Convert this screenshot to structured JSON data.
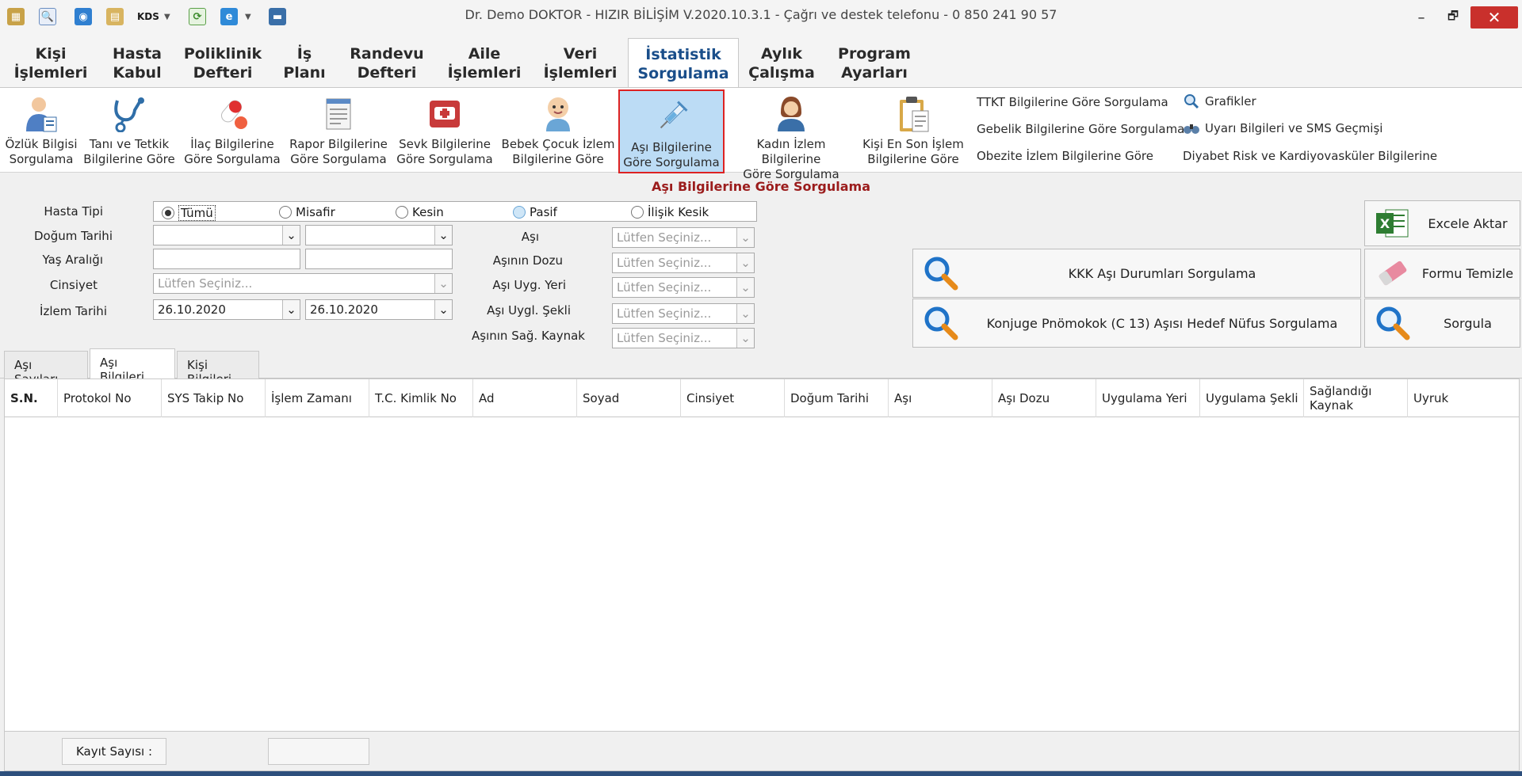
{
  "window": {
    "title": "Dr. Demo DOKTOR - HIZIR BİLİŞİM V.2020.10.3.1 - Çağrı ve destek telefonu - 0 850 241 90 57",
    "quick_access": {
      "kds_label": "KDS"
    },
    "controls": {
      "minimize": "–",
      "restore": "🗗",
      "close": "✕"
    }
  },
  "menu_tabs": [
    {
      "label": "Kişi\nİşlemleri"
    },
    {
      "label": "Hasta\nKabul"
    },
    {
      "label": "Poliklinik\nDefteri"
    },
    {
      "label": "İş\nPlanı"
    },
    {
      "label": "Randevu\nDefteri"
    },
    {
      "label": "Aile\nİşlemleri"
    },
    {
      "label": "Veri\nİşlemleri"
    },
    {
      "label": "İstatistik\nSorgulama"
    },
    {
      "label": "Aylık\nÇalışma"
    },
    {
      "label": "Program\nAyarları"
    }
  ],
  "ribbon": {
    "buttons": [
      {
        "label": "Özlük Bilgisi\nSorgulama",
        "icon": "doctor-icon"
      },
      {
        "label": "Tanı ve Tetkik\nBilgilerine Göre",
        "icon": "stethoscope-icon"
      },
      {
        "label": "İlaç Bilgilerine\nGöre Sorgulama",
        "icon": "pills-icon"
      },
      {
        "label": "Rapor Bilgilerine\nGöre Sorgulama",
        "icon": "report-icon"
      },
      {
        "label": "Sevk Bilgilerine\nGöre Sorgulama",
        "icon": "ambulance-icon"
      },
      {
        "label": "Bebek Çocuk İzlem\nBilgilerine Göre",
        "icon": "baby-icon"
      },
      {
        "label": "Aşı Bilgilerine\nGöre Sorgulama",
        "icon": "syringe-icon"
      },
      {
        "label": "Kadın İzlem Bilgilerine\nGöre Sorgulama",
        "icon": "woman-icon"
      },
      {
        "label": "Kişi En Son İşlem\nBilgilerine Göre",
        "icon": "clipboard-icon"
      }
    ],
    "links_col1": [
      "TTKT Bilgilerine Göre Sorgulama",
      "Gebelik Bilgilerine Göre Sorgulama",
      "Obezite İzlem Bilgilerine Göre"
    ],
    "links_col2": [
      "Grafikler",
      "Uyarı Bilgileri ve SMS Geçmişi",
      "Diyabet Risk ve Kardiyovasküler Bilgilerine"
    ]
  },
  "form": {
    "title": "Aşı Bilgilerine Göre Sorgulama",
    "labels": {
      "hasta_tipi": "Hasta Tipi",
      "dogum_tarihi": "Doğum Tarihi",
      "yas_araligi": "Yaş Aralığı",
      "cinsiyet": "Cinsiyet",
      "izlem_tarihi": "İzlem Tarihi",
      "asi": "Aşı",
      "asinin_dozu": "Aşının Dozu",
      "asi_uyg_yeri": "Aşı Uyg. Yeri",
      "asi_uygl_sekli": "Aşı Uygl. Şekli",
      "asinin_sag_kaynak": "Aşının Sağ. Kaynak"
    },
    "radio_options": [
      "Tümü",
      "Misafir",
      "Kesin",
      "Pasif",
      "İlişik Kesik"
    ],
    "placeholder": "Lütfen Seçiniz...",
    "izlem_start": "26.10.2020",
    "izlem_end": "26.10.2020"
  },
  "actions": {
    "excel": "Excele Aktar",
    "kkk": "KKK Aşı Durumları Sorgulama",
    "temizle": "Formu Temizle",
    "konjuge": "Konjuge Pnömokok (C 13) Aşısı Hedef Nüfus Sorgulama",
    "sorgula": "Sorgula"
  },
  "sub_tabs": [
    "Aşı Sayıları",
    "Aşı Bilgileri",
    "Kişi Bilgileri"
  ],
  "grid": {
    "columns": [
      "S.N.",
      "Protokol No",
      "SYS Takip No",
      "İşlem Zamanı",
      "T.C. Kimlik No",
      "Ad",
      "Soyad",
      "Cinsiyet",
      "Doğum Tarihi",
      "Aşı",
      "Aşı Dozu",
      "Uygulama Yeri",
      "Uygulama Şekli",
      "Sağlandığı\nKaynak",
      "Uyruk"
    ],
    "rows": []
  },
  "footer": {
    "count_label": "Kayıt Sayısı :",
    "count_value": ""
  },
  "colors": {
    "accent_red": "#9b1c1c",
    "active_tab_text": "#1a4e8a",
    "selected_ribbon_bg": "#bcdcf5",
    "close_button": "#c9302c"
  }
}
